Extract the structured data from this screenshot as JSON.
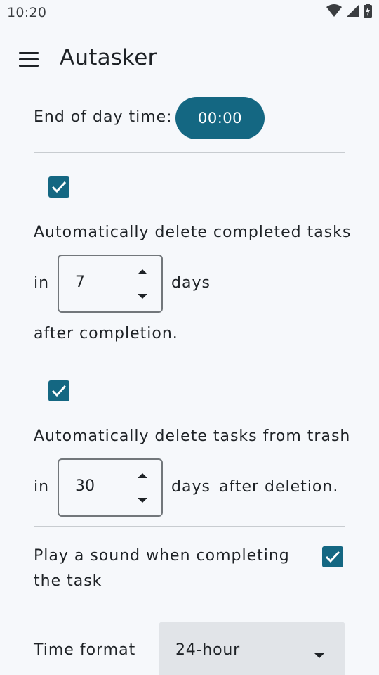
{
  "status_bar": {
    "time": "10:20",
    "icons": [
      "wifi-icon",
      "cell-signal-icon",
      "battery-charging-icon"
    ]
  },
  "app_bar": {
    "title": "Autasker",
    "menu_icon": "menu-icon"
  },
  "settings": {
    "end_of_day": {
      "label": "End of day time:",
      "value": "00:00"
    },
    "auto_delete_completed": {
      "checked": true,
      "label": "Automatically delete completed tasks",
      "in_label": "in",
      "value": "7",
      "unit_label": "days",
      "suffix_label": "after completion."
    },
    "auto_delete_trash": {
      "checked": true,
      "label": "Automatically delete tasks from trash",
      "in_label": "in",
      "value": "30",
      "unit_label": "days",
      "suffix_label": "after deletion."
    },
    "play_sound": {
      "label_line1": "Play a sound when completing",
      "label_line2": "the task",
      "checked": true
    },
    "time_format": {
      "label": "Time format",
      "value": "24-hour"
    }
  },
  "colors": {
    "accent": "#146782",
    "background": "#f6f8fb",
    "divider": "#c8ccd0",
    "select_bg": "#e1e4e8"
  }
}
